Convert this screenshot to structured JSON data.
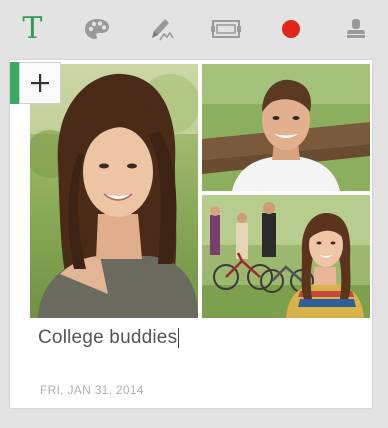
{
  "toolbar": {
    "tools": [
      {
        "icon": "text-icon",
        "glyph": "T",
        "color": "#2f9b55"
      },
      {
        "icon": "palette-icon",
        "color": "#9a9a9a"
      },
      {
        "icon": "pen-icon",
        "color": "#9a9a9a"
      },
      {
        "icon": "photo-frame-icon",
        "color": "#9a9a9a"
      },
      {
        "icon": "record-icon",
        "color": "#e0261b"
      },
      {
        "icon": "stamp-icon",
        "color": "#9a9a9a"
      }
    ]
  },
  "note": {
    "add_button_icon": "plus-icon",
    "accent_color": "#3aa965",
    "caption": "College buddies",
    "date": "FRI, JAN 31, 2014"
  },
  "photos": [
    {
      "icon": "photo-woman-icon"
    },
    {
      "icon": "photo-man-icon"
    },
    {
      "icon": "photo-woman-bikes-icon"
    }
  ]
}
